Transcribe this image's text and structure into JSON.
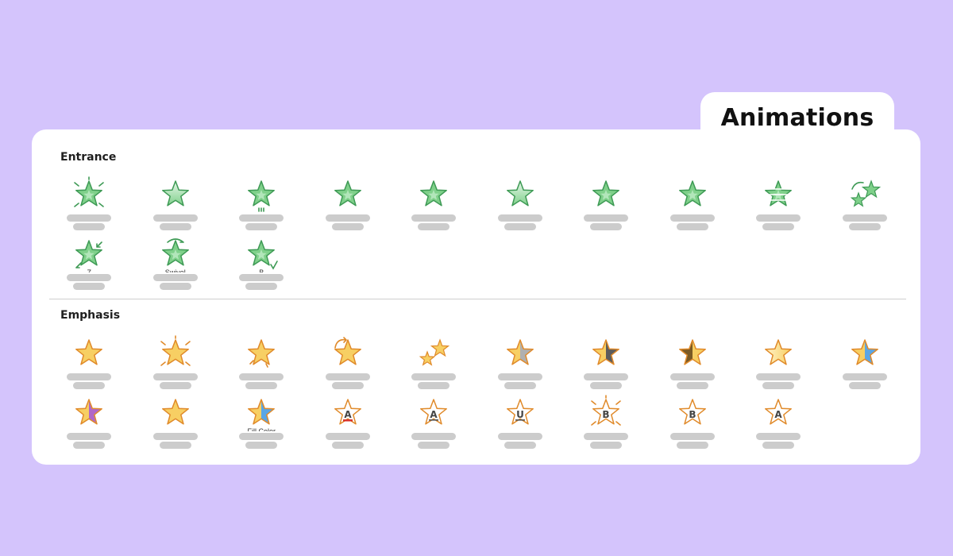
{
  "header": {
    "tab_title": "Animations"
  },
  "colors": {
    "background": "#d4c4fc",
    "panel": "#ffffff",
    "placeholder_bar": "#cccccc",
    "entrance_star": "#7fd08a",
    "emphasis_star": "#f7cf63"
  },
  "sections": [
    {
      "label": "Entrance",
      "rows": [
        [
          {
            "id": "entrance-appear",
            "icon": "star-burst-green-icon"
          },
          {
            "id": "entrance-fade",
            "icon": "star-faded-green-icon"
          },
          {
            "id": "entrance-fly-in",
            "icon": "star-fly-in-green-icon"
          },
          {
            "id": "entrance-float-in",
            "icon": "star-float-in-green-icon"
          },
          {
            "id": "entrance-split",
            "icon": "star-split-green-icon"
          },
          {
            "id": "entrance-wipe",
            "icon": "star-wipe-green-icon"
          },
          {
            "id": "entrance-shape",
            "icon": "star-shape-green-icon"
          },
          {
            "id": "entrance-wheel",
            "icon": "star-wheel-green-icon"
          },
          {
            "id": "entrance-random-bars",
            "icon": "star-random-bars-green-icon"
          },
          {
            "id": "entrance-grow-turn",
            "icon": "star-grow-turn-green-icon"
          }
        ],
        [
          {
            "id": "entrance-zoom",
            "icon": "star-zoom-green-icon",
            "caption": "Z"
          },
          {
            "id": "entrance-swivel",
            "icon": "star-swivel-green-icon",
            "caption": "Swivel"
          },
          {
            "id": "entrance-bounce",
            "icon": "star-bounce-green-icon",
            "caption": "B"
          }
        ]
      ]
    },
    {
      "label": "Emphasis",
      "rows": [
        [
          {
            "id": "emphasis-pulse",
            "icon": "star-pulse-gold-icon"
          },
          {
            "id": "emphasis-color-pulse",
            "icon": "star-color-pulse-gold-icon"
          },
          {
            "id": "emphasis-teeter",
            "icon": "star-teeter-gold-icon"
          },
          {
            "id": "emphasis-spin",
            "icon": "star-spin-gold-icon"
          },
          {
            "id": "emphasis-grow-shrink",
            "icon": "star-grow-shrink-gold-icon"
          },
          {
            "id": "emphasis-desaturate",
            "icon": "star-desaturate-gold-icon"
          },
          {
            "id": "emphasis-darken",
            "icon": "star-darken-gold-icon"
          },
          {
            "id": "emphasis-lighten",
            "icon": "star-lighten-gold-icon"
          },
          {
            "id": "emphasis-transparency",
            "icon": "star-transparency-gold-icon"
          },
          {
            "id": "emphasis-object-color",
            "icon": "star-object-color-gold-icon"
          }
        ],
        [
          {
            "id": "emphasis-complementary-color",
            "icon": "star-complementary-gold-icon"
          },
          {
            "id": "emphasis-line-color",
            "icon": "star-line-color-gold-icon"
          },
          {
            "id": "emphasis-fill-color",
            "icon": "star-fill-color-gold-icon",
            "caption": "Fill Color"
          },
          {
            "id": "emphasis-brush-color",
            "icon": "star-brush-color-outline-icon",
            "letter": "A"
          },
          {
            "id": "emphasis-font-color",
            "icon": "star-font-color-outline-icon",
            "letter": "A"
          },
          {
            "id": "emphasis-underline",
            "icon": "star-underline-outline-icon",
            "letter": "U"
          },
          {
            "id": "emphasis-bold-flash",
            "icon": "star-bold-flash-outline-icon",
            "letter": "B"
          },
          {
            "id": "emphasis-bold-reveal",
            "icon": "star-bold-reveal-outline-icon",
            "letter": "B"
          },
          {
            "id": "emphasis-wave",
            "icon": "star-wave-outline-icon",
            "letter": "A"
          }
        ]
      ]
    }
  ]
}
